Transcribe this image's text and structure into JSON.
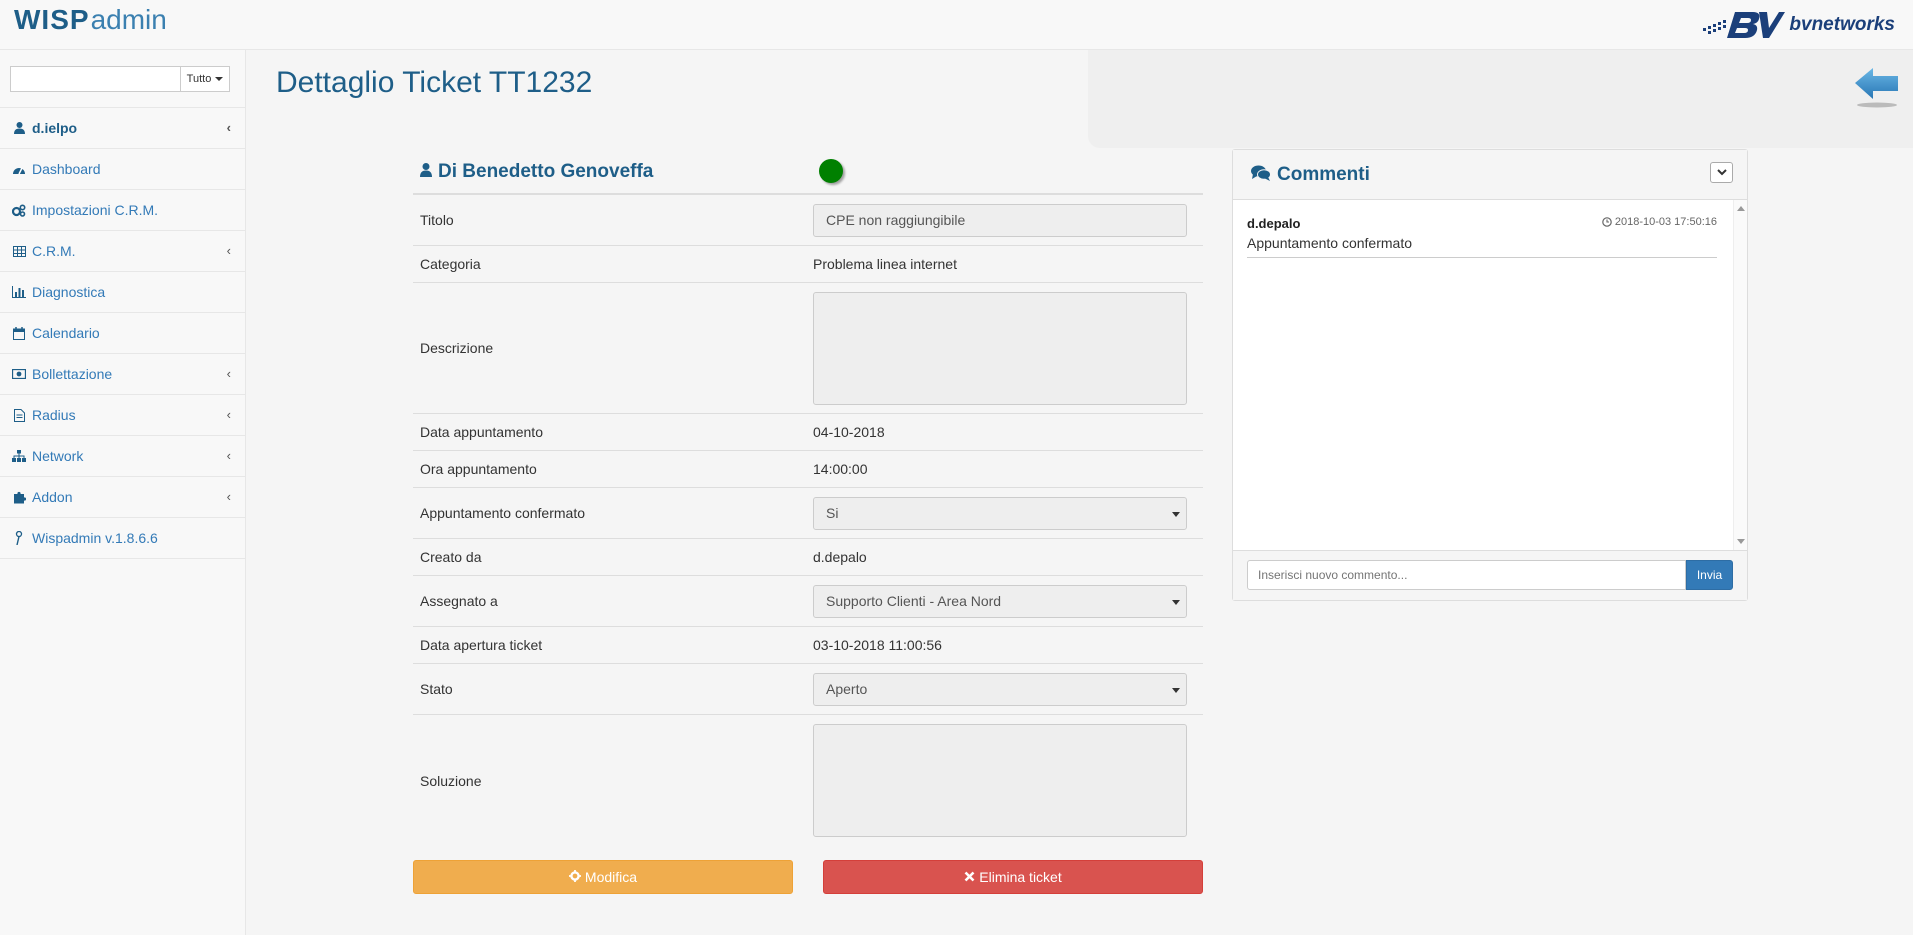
{
  "header": {
    "logo_wisp": "WISP",
    "logo_admin": "admin",
    "brand_text": "bvnetworks"
  },
  "sidebar": {
    "search": {
      "placeholder": "",
      "filter_label": "Tutto"
    },
    "user": "d.ielpo",
    "items": [
      {
        "label": "Dashboard",
        "icon": "dashboard-icon"
      },
      {
        "label": "Impostazioni C.R.M.",
        "icon": "gears-icon"
      },
      {
        "label": "C.R.M.",
        "icon": "table-icon"
      },
      {
        "label": "Diagnostica",
        "icon": "bar-chart-icon"
      },
      {
        "label": "Calendario",
        "icon": "calendar-icon"
      },
      {
        "label": "Bollettazione",
        "icon": "money-icon"
      },
      {
        "label": "Radius",
        "icon": "document-icon"
      },
      {
        "label": "Network",
        "icon": "sitemap-icon"
      },
      {
        "label": "Addon",
        "icon": "puzzle-icon"
      },
      {
        "label": "Wispadmin v.1.8.6.6",
        "icon": "antenna-icon"
      }
    ]
  },
  "page": {
    "title": "Dettaglio Ticket TT1232"
  },
  "ticket": {
    "customer": "Di Benedetto Genoveffa",
    "status_color": "#008000",
    "titolo_label": "Titolo",
    "titolo_value": "CPE non raggiungibile",
    "categoria_label": "Categoria",
    "categoria_value": "Problema linea internet",
    "descrizione_label": "Descrizione",
    "data_app_label": "Data appuntamento",
    "data_app_value": "04-10-2018",
    "ora_app_label": "Ora appuntamento",
    "ora_app_value": "14:00:00",
    "confermato_label": "Appuntamento confermato",
    "confermato_value": "Si",
    "creato_label": "Creato da",
    "creato_value": "d.depalo",
    "assegnato_label": "Assegnato a",
    "assegnato_value": "Supporto Clienti - Area Nord",
    "apertura_label": "Data apertura ticket",
    "apertura_value": "03-10-2018 11:00:56",
    "stato_label": "Stato",
    "stato_value": "Aperto",
    "soluzione_label": "Soluzione",
    "edit_label": "Modifica",
    "delete_label": "Elimina ticket"
  },
  "comments": {
    "title": "Commenti",
    "items": [
      {
        "user": "d.depalo",
        "time": "2018-10-03 17:50:16",
        "text": "Appuntamento confermato"
      }
    ],
    "input_placeholder": "Inserisci nuovo commento...",
    "send_label": "Invia"
  }
}
